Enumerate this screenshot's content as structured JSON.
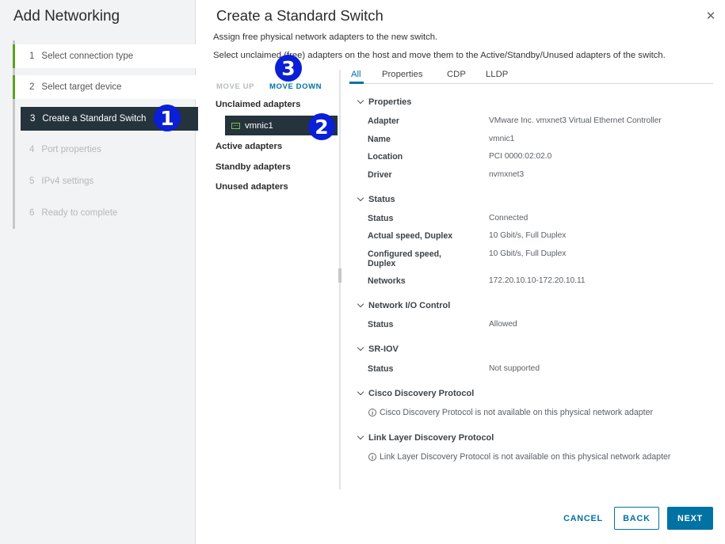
{
  "wizard": {
    "title": "Add Networking",
    "steps": [
      {
        "num": "1",
        "label": "Select connection type",
        "state": "done"
      },
      {
        "num": "2",
        "label": "Select target device",
        "state": "done"
      },
      {
        "num": "3",
        "label": "Create a Standard Switch",
        "state": "active"
      },
      {
        "num": "4",
        "label": "Port properties",
        "state": "todo"
      },
      {
        "num": "5",
        "label": "IPv4 settings",
        "state": "todo"
      },
      {
        "num": "6",
        "label": "Ready to complete",
        "state": "todo"
      }
    ]
  },
  "callouts": [
    "1",
    "2",
    "3"
  ],
  "dialog": {
    "title": "Create a Standard Switch",
    "close_glyph": "✕",
    "desc1": "Assign free physical network adapters to the new switch.",
    "desc2": "Select unclaimed (free) adapters on the host and move them to the Active/Standby/Unused adapters of the switch."
  },
  "adapters": {
    "move_up": "MOVE UP",
    "move_down": "MOVE DOWN",
    "groups": {
      "unclaimed": "Unclaimed adapters",
      "active": "Active adapters",
      "standby": "Standby adapters",
      "unused": "Unused adapters"
    },
    "selected": "vmnic1"
  },
  "tabs": [
    "All",
    "Properties",
    "CDP",
    "LLDP"
  ],
  "details": {
    "properties": {
      "title": "Properties",
      "rows": [
        {
          "k": "Adapter",
          "v": "VMware Inc. vmxnet3 Virtual Ethernet Controller"
        },
        {
          "k": "Name",
          "v": "vmnic1"
        },
        {
          "k": "Location",
          "v": "PCI 0000:02:02.0"
        },
        {
          "k": "Driver",
          "v": "nvmxnet3"
        }
      ]
    },
    "status": {
      "title": "Status",
      "rows": [
        {
          "k": "Status",
          "v": "Connected"
        },
        {
          "k": "Actual speed, Duplex",
          "v": "10 Gbit/s, Full Duplex"
        },
        {
          "k": "Configured speed, Duplex",
          "v": "10 Gbit/s, Full Duplex"
        },
        {
          "k": "Networks",
          "v": "172.20.10.10-172.20.10.11"
        }
      ]
    },
    "nioc": {
      "title": "Network I/O Control",
      "rows": [
        {
          "k": "Status",
          "v": "Allowed"
        }
      ]
    },
    "sriov": {
      "title": "SR-IOV",
      "rows": [
        {
          "k": "Status",
          "v": "Not supported"
        }
      ]
    },
    "cdp": {
      "title": "Cisco Discovery Protocol",
      "note": "Cisco Discovery Protocol is not available on this physical network adapter"
    },
    "lldp": {
      "title": "Link Layer Discovery Protocol",
      "note": "Link Layer Discovery Protocol is not available on this physical network adapter"
    }
  },
  "footer": {
    "cancel": "CANCEL",
    "back": "BACK",
    "next": "NEXT"
  },
  "colors": {
    "accent": "#0072a3",
    "active_step": "#25333d",
    "done_bar": "#5aa220",
    "callout": "#0a1fd6"
  }
}
